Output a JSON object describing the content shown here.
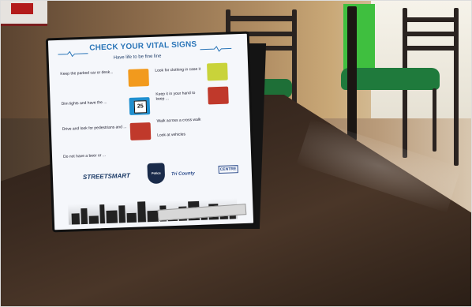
{
  "photo": {
    "description_key": "restaurant-table-tent-card"
  },
  "card": {
    "title": "CHECK YOUR VITAL SIGNS",
    "subtitle": "Have life to be fine line",
    "items_left": [
      "Keep the parked car or desk...",
      "Dim lights and have the ...",
      "Drive and look for pedestrians and ...",
      "Do not have a beer or ..."
    ],
    "items_right": [
      "Look for clothing in case it",
      "Keep it in your hand to keep ...",
      "Walk across a cross walk",
      "Look at vehicles"
    ],
    "badge_number": "25",
    "logo_left": "STREETSMART",
    "logo_mid": "Police",
    "logo_right": "Tri County",
    "logo_far_right": "CENTRE"
  },
  "colors": {
    "title_blue": "#2a75b8",
    "icon_orange": "#f29a1d",
    "icon_blue": "#1f8fcf",
    "icon_red": "#c0392b",
    "icon_yellow": "#c9d33a",
    "seat_green": "#1f7a3c"
  }
}
